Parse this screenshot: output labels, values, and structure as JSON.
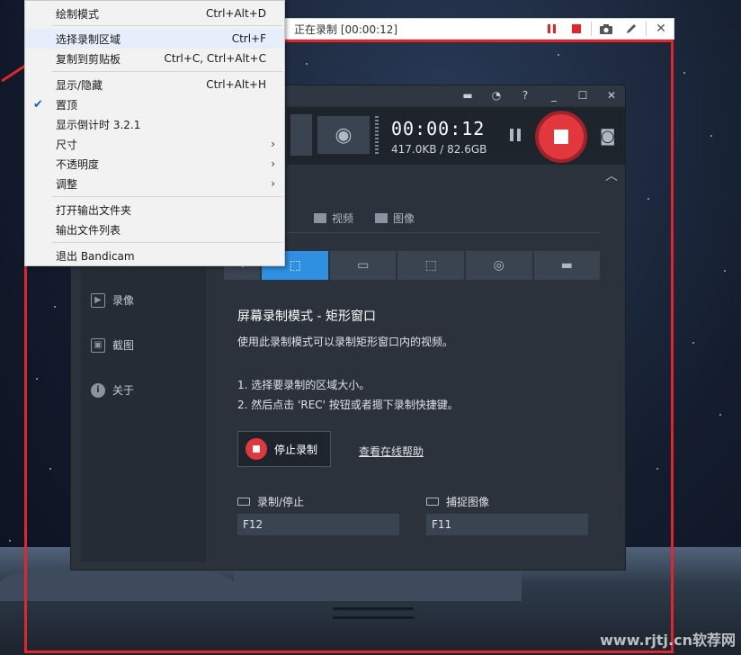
{
  "capture_bar": {
    "status": "正在录制 [00:00:12]"
  },
  "context_menu": {
    "items": [
      {
        "label": "绘制模式",
        "shortcut": "Ctrl+Alt+D"
      },
      {
        "label": "选择录制区域",
        "shortcut": "Ctrl+F"
      },
      {
        "label": "复制到剪贴板",
        "shortcut": "Ctrl+C, Ctrl+Alt+C"
      },
      {
        "label": "显示/隐藏",
        "shortcut": "Ctrl+Alt+H"
      },
      {
        "label": "置顶",
        "shortcut": ""
      },
      {
        "label": "显示倒计时 3.2.1",
        "shortcut": ""
      },
      {
        "label": "尺寸",
        "shortcut": ""
      },
      {
        "label": "不透明度",
        "shortcut": ""
      },
      {
        "label": "调整",
        "shortcut": ""
      },
      {
        "label": "打开输出文件夹",
        "shortcut": ""
      },
      {
        "label": "输出文件列表",
        "shortcut": ""
      },
      {
        "label": "退出 Bandicam",
        "shortcut": ""
      }
    ]
  },
  "recorder": {
    "timer": "00:00:12",
    "size_info": "417.0KB / 82.6GB"
  },
  "sidebar": {
    "items": [
      "录像",
      "截图",
      "关于"
    ]
  },
  "tabs": [
    "视频",
    "图像"
  ],
  "main": {
    "mode_title": "屏幕录制模式 - 矩形窗口",
    "mode_desc": "使用此录制模式可以录制矩形窗口内的视频。",
    "step1": "1. 选择要录制的区域大小。",
    "step2": "2. 然后点击 'REC' 按钮或者摁下录制快捷键。",
    "stop_button": "停止录制",
    "help_link": "查看在线帮助"
  },
  "hotkeys": {
    "record_label": "录制/停止",
    "record_key": "F12",
    "capture_label": "捕捉图像",
    "capture_key": "F11"
  },
  "watermark": "www.rjtj.cn软荐网",
  "colors": {
    "capture_frame": "#e0262b",
    "record_button": "#e2373d",
    "active_mode": "#2f8fe0"
  }
}
